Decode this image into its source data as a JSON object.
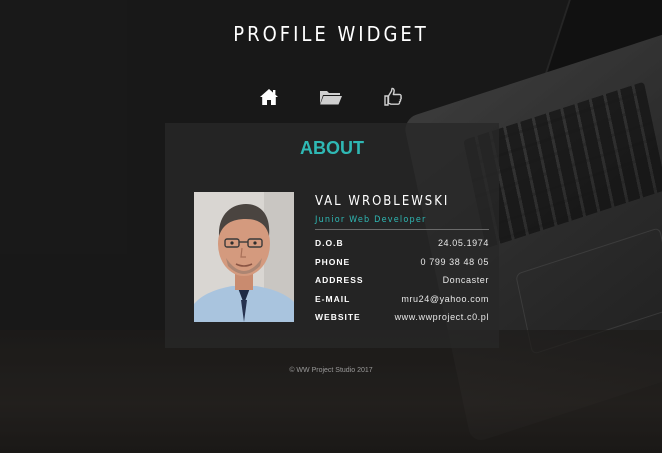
{
  "header": {
    "title": "PROFILE WIDGET"
  },
  "nav": [
    {
      "icon": "home-icon"
    },
    {
      "icon": "folder-open-icon"
    },
    {
      "icon": "thumbs-up-icon"
    }
  ],
  "about": {
    "heading": "ABOUT",
    "name": "VAL WROBLEWSKI",
    "role": "Junior Web Developer",
    "details": [
      {
        "label": "D.O.B",
        "value": "24.05.1974"
      },
      {
        "label": "PHONE",
        "value": "0 799 38 48 05"
      },
      {
        "label": "ADDRESS",
        "value": "Doncaster"
      },
      {
        "label": "E-MAIL",
        "value": "mru24@yahoo.com"
      },
      {
        "label": "WEBSITE",
        "value": "www.wwproject.c0.pl"
      }
    ]
  },
  "footer": {
    "text": "© WW Project Studio 2017"
  },
  "colors": {
    "accent": "#2fb8b4",
    "background": "#262626",
    "card": "#282828"
  }
}
